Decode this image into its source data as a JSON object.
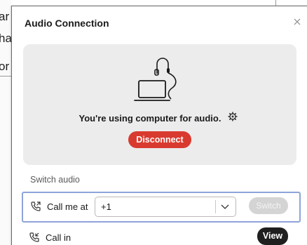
{
  "background_window": {
    "fragments": [
      "ar",
      "ha",
      "or"
    ]
  },
  "dialog": {
    "title": "Audio Connection",
    "close_icon": "close-icon"
  },
  "status": {
    "icon": "computer-headset-icon",
    "text": "You're using computer for audio.",
    "settings_icon": "gear-icon",
    "disconnect_label": "Disconnect",
    "disconnect_color": "#d93a2f"
  },
  "switch_audio": {
    "section_label": "Switch audio",
    "call_me": {
      "icon": "phone-outgoing-icon",
      "label": "Call me at",
      "country_code": "+1",
      "dropdown_icon": "chevron-down-icon",
      "switch_label": "Switch",
      "switch_enabled": false
    },
    "call_in": {
      "icon": "phone-incoming-icon",
      "label": "Call in",
      "view_label": "View"
    }
  },
  "colors": {
    "focus_outline": "#8ea3d9",
    "panel_bg": "#ececec",
    "view_button": "#1f1f1f"
  }
}
